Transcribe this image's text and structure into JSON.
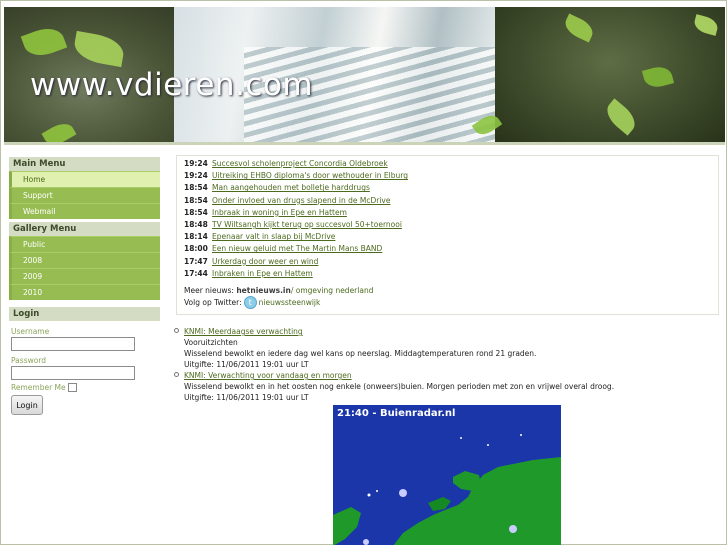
{
  "header": {
    "site_title": "www.vdieren.com"
  },
  "sidebar": {
    "main_menu": {
      "title": "Main Menu",
      "items": [
        {
          "label": "Home",
          "active": true
        },
        {
          "label": "Support",
          "active": false
        },
        {
          "label": "Webmail",
          "active": false
        }
      ]
    },
    "gallery_menu": {
      "title": "Gallery Menu",
      "items": [
        {
          "label": "Public"
        },
        {
          "label": "2008"
        },
        {
          "label": "2009"
        },
        {
          "label": "2010"
        }
      ]
    },
    "login": {
      "title": "Login",
      "username_label": "Username",
      "username_value": "",
      "password_label": "Password",
      "password_value": "",
      "remember_label": "Remember Me",
      "button_label": "Login"
    }
  },
  "news": {
    "items": [
      {
        "time": "19:24",
        "title": "Succesvol scholenproject Concordia Oldebroek"
      },
      {
        "time": "19:24",
        "title": "Uitreiking EHBO diploma's door wethouder in Elburg"
      },
      {
        "time": "18:54",
        "title": "Man aangehouden met bolletje harddrugs"
      },
      {
        "time": "18:54",
        "title": "Onder invloed van drugs slapend in de McDrive"
      },
      {
        "time": "18:54",
        "title": "Inbraak in woning in Epe en Hattem"
      },
      {
        "time": "18:48",
        "title": "TV Wiltsangh kijkt terug op succesvol 50+toernooi"
      },
      {
        "time": "18:14",
        "title": "Epenaar valt in slaap bij McDrive"
      },
      {
        "time": "18:00",
        "title": "Een nieuw geluid met The Martin Mans BAND"
      },
      {
        "time": "17:47",
        "title": "Urkerdag door weer en wind"
      },
      {
        "time": "17:44",
        "title": "Inbraken in Epe en Hattem"
      }
    ],
    "more_prefix": "Meer nieuws:",
    "more_source": "hetnieuws.in",
    "more_link": "/ omgeving nederland",
    "twitter_prefix": "Volg op Twitter:",
    "twitter_icon": "twitter-bird-icon",
    "twitter_handle": "nieuwssteenwijk"
  },
  "forecast": {
    "items": [
      {
        "link": "KNMI: Meerdaagse verwachting",
        "lines": [
          "Vooruitzichten",
          "Wisselend bewolkt en iedere dag wel kans op neerslag. Middagtemperaturen rond 21 graden.",
          "Uitgifte: 11/06/2011 19:01 uur LT"
        ]
      },
      {
        "link": "KNMI: Verwachting voor vandaag en morgen",
        "lines": [
          "Wisselend bewolkt en in het oosten nog enkele (onweers)buien. Morgen perioden met zon en vrijwel overal droog.",
          "Uitgifte: 11/06/2011 19:01 uur LT"
        ]
      }
    ]
  },
  "radar": {
    "title": "21:40 - Buienradar.nl"
  },
  "colors": {
    "menu_green": "#97bd52",
    "menu_active": "#e0f0ae",
    "link_green": "#4d6b1f",
    "radar_sea": "#1a36a8",
    "radar_land": "#1f9a2a"
  }
}
